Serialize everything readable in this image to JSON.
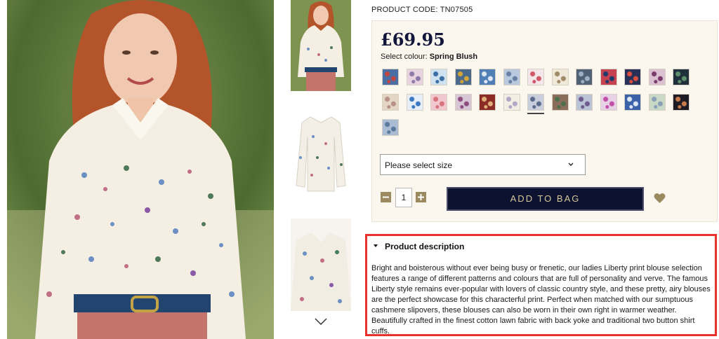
{
  "product": {
    "code_label": "PRODUCT CODE: TN07505",
    "price": "£69.95",
    "colour_prefix": "Select colour: ",
    "colour_name": "Spring Blush"
  },
  "swatches": [
    {
      "name": "swatch-1",
      "color": "#4a6fa5",
      "accent": "#c0463f"
    },
    {
      "name": "swatch-2",
      "color": "#e8d4e0",
      "accent": "#8c7aa8"
    },
    {
      "name": "swatch-3",
      "color": "#cfe2ef",
      "accent": "#3a6ea5"
    },
    {
      "name": "swatch-4",
      "color": "#496a8a",
      "accent": "#d3a437"
    },
    {
      "name": "swatch-5",
      "color": "#4f7fb5",
      "accent": "#dfe8f2"
    },
    {
      "name": "swatch-6",
      "color": "#b9c9de",
      "accent": "#6780a4"
    },
    {
      "name": "swatch-7",
      "color": "#f3e7e9",
      "accent": "#d05869"
    },
    {
      "name": "swatch-8",
      "color": "#f0e8d8",
      "accent": "#a08a68"
    },
    {
      "name": "swatch-9",
      "color": "#4f6174",
      "accent": "#9db2c8"
    },
    {
      "name": "swatch-10",
      "color": "#c64250",
      "accent": "#203a6a"
    },
    {
      "name": "swatch-11",
      "color": "#283058",
      "accent": "#d94e3e"
    },
    {
      "name": "swatch-12",
      "color": "#dcc2d0",
      "accent": "#7a3a6a"
    },
    {
      "name": "swatch-13",
      "color": "#1f2f3c",
      "accent": "#5f8f6a"
    },
    {
      "name": "swatch-14",
      "color": "#e3d6c5",
      "accent": "#b78f87"
    },
    {
      "name": "swatch-15",
      "color": "#e6eef7",
      "accent": "#3d78c4"
    },
    {
      "name": "swatch-16",
      "color": "#f2c8d0",
      "accent": "#d8737f"
    },
    {
      "name": "swatch-17",
      "color": "#d7c6d6",
      "accent": "#8d4e7e"
    },
    {
      "name": "swatch-18",
      "color": "#8a2c25",
      "accent": "#e0b07a"
    },
    {
      "name": "swatch-19",
      "color": "#f3eee4",
      "accent": "#b3a6c7"
    },
    {
      "name": "swatch-20",
      "color": "#c8cedc",
      "accent": "#5b6b8c"
    },
    {
      "name": "swatch-21",
      "color": "#8a6e5b",
      "accent": "#4c6f4a"
    },
    {
      "name": "swatch-22",
      "color": "#b9c4d6",
      "accent": "#6f5a8c"
    },
    {
      "name": "swatch-23",
      "color": "#e7d1e6",
      "accent": "#c24ea8"
    },
    {
      "name": "swatch-24",
      "color": "#3b62a8",
      "accent": "#dce6f4"
    },
    {
      "name": "swatch-25",
      "color": "#c8d9c6",
      "accent": "#8a9fb8"
    },
    {
      "name": "swatch-26",
      "color": "#1d1c24",
      "accent": "#c87a4a"
    },
    {
      "name": "swatch-27",
      "color": "#a9bcd4",
      "accent": "#5a7a9c"
    }
  ],
  "selected_swatch_index": 19,
  "size_select": {
    "placeholder": "Please select size"
  },
  "quantity": {
    "value": "1"
  },
  "buttons": {
    "add_to_bag": "ADD TO BAG"
  },
  "description": {
    "heading": "Product description",
    "body": "Bright and boisterous without ever being busy or frenetic, our ladies Liberty print blouse selection features a range of different patterns and colours that are full of personality and verve. The famous Liberty style remains ever-popular with lovers of classic country style, and these pretty, airy blouses are the perfect showcase for this characterful print. Perfect when matched with our sumptuous cashmere slipovers, these blouses can also be worn in their own right in warmer weather. Beautifully crafted in the finest cotton lawn fabric with back yoke and traditional two button shirt cuffs."
  },
  "colors": {
    "navy": "#0e1231",
    "gold": "#d4c79a",
    "panel": "#fbf6ee",
    "highlight_border": "#e8322a",
    "qty_button": "#9b8a60"
  }
}
